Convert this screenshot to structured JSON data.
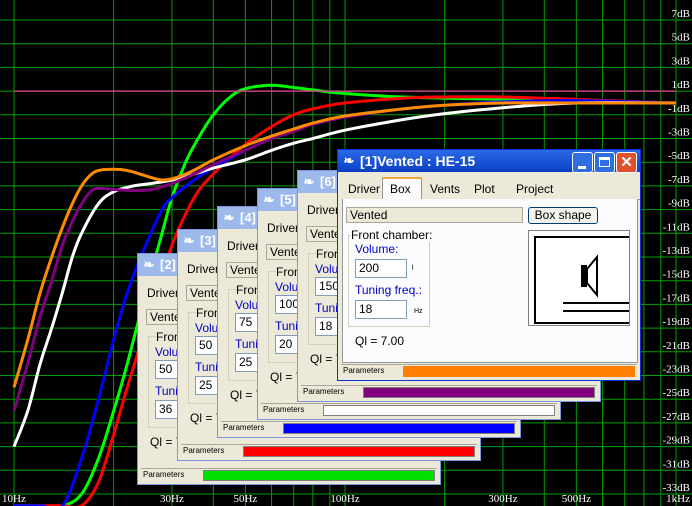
{
  "chart_data": {
    "type": "line",
    "y_labels": [
      "7dB",
      "5dB",
      "3dB",
      "1dB",
      "-1dB",
      "-3dB",
      "-5dB",
      "-7dB",
      "-9dB",
      "-11dB",
      "-13dB",
      "-15dB",
      "-17dB",
      "-19dB",
      "-21dB",
      "-23dB",
      "-25dB",
      "-27dB",
      "-29dB",
      "-31dB",
      "-33dB"
    ],
    "x_labels": [
      "10Hz",
      "30Hz",
      "50Hz",
      "100Hz",
      "300Hz",
      "500Hz",
      "1kHz"
    ],
    "x_log": true,
    "xlim": [
      10,
      1000
    ],
    "ylim": [
      -34,
      8
    ],
    "grid": true,
    "series": [
      {
        "color": "#00ff00",
        "x": [
          10,
          12,
          14,
          16,
          18,
          20,
          22,
          25,
          28,
          30,
          33,
          36,
          40,
          45,
          50,
          60,
          70,
          80,
          100,
          150,
          300,
          1000
        ],
        "y": [
          -34,
          -34,
          -34,
          -33,
          -30,
          -26,
          -22,
          -16,
          -11,
          -8,
          -5,
          -3,
          -1,
          0.5,
          1.2,
          1.5,
          1.3,
          1.1,
          0.8,
          0.5,
          0.3,
          0
        ]
      },
      {
        "color": "#ff0000",
        "x": [
          10,
          12,
          14,
          16,
          18,
          20,
          22,
          25,
          28,
          30,
          35,
          40,
          50,
          60,
          70,
          80,
          100,
          150,
          200,
          300,
          500,
          1000
        ],
        "y": [
          -34,
          -34,
          -34,
          -34,
          -32,
          -28,
          -24,
          -19,
          -15,
          -12,
          -8,
          -6,
          -3.5,
          -2,
          -1,
          -0.5,
          0,
          0.4,
          0.5,
          0.5,
          0.3,
          0
        ]
      },
      {
        "color": "#0000ff",
        "x": [
          10,
          12,
          14,
          16,
          18,
          20,
          22,
          25,
          28,
          30,
          35,
          40,
          50,
          60,
          70,
          80,
          100,
          150,
          200,
          300,
          500,
          1000
        ],
        "y": [
          -34,
          -34,
          -34,
          -30,
          -25,
          -20,
          -16,
          -12,
          -9,
          -8,
          -6.5,
          -5.5,
          -4,
          -3,
          -2.3,
          -1.8,
          -1.2,
          -0.5,
          -0.2,
          0.1,
          0.2,
          0
        ]
      },
      {
        "color": "#ffffff",
        "x": [
          10,
          11,
          12,
          13,
          14,
          15,
          16,
          18,
          20,
          23,
          26,
          30,
          35,
          40,
          50,
          60,
          70,
          80,
          100,
          150,
          200,
          300,
          500,
          1000
        ],
        "y": [
          -29,
          -26,
          -22,
          -19,
          -16,
          -13,
          -11,
          -8.5,
          -7.5,
          -7,
          -6.8,
          -6.5,
          -6,
          -5.5,
          -4.8,
          -4,
          -3.4,
          -3,
          -2.3,
          -1.4,
          -0.9,
          -0.4,
          0,
          0
        ]
      },
      {
        "color": "#800080",
        "x": [
          10,
          11,
          12,
          13,
          14,
          15,
          16,
          17,
          18,
          20,
          23,
          26,
          30,
          35,
          40,
          50,
          60,
          70,
          80,
          100,
          150,
          200,
          300,
          500,
          1000
        ],
        "y": [
          -26,
          -22,
          -18,
          -15,
          -12,
          -10,
          -8.5,
          -7.5,
          -7.2,
          -7.3,
          -7.4,
          -7.3,
          -6.8,
          -6,
          -5.2,
          -4,
          -3,
          -2.4,
          -1.8,
          -1.2,
          -0.5,
          -0.2,
          0,
          0,
          0
        ]
      },
      {
        "color": "#ff8c00",
        "x": [
          10,
          11,
          12,
          13,
          14,
          15,
          16,
          17,
          18,
          20,
          22,
          24,
          26,
          28,
          30,
          33,
          36,
          40,
          50,
          60,
          70,
          80,
          100,
          150,
          200,
          300,
          500,
          1000
        ],
        "y": [
          -24,
          -20,
          -16,
          -13,
          -10.5,
          -8.5,
          -7,
          -6.1,
          -5.7,
          -5.6,
          -5.7,
          -6,
          -6.3,
          -6.5,
          -6.4,
          -6,
          -5.5,
          -4.8,
          -3.6,
          -2.8,
          -2.2,
          -1.7,
          -1.1,
          -0.5,
          -0.2,
          0,
          0,
          0
        ]
      },
      {
        "color": "#c04080",
        "x": [
          10,
          1000
        ],
        "y": [
          1,
          1
        ]
      }
    ]
  },
  "windows": [
    {
      "title": "[2]",
      "tab": "Driver",
      "vented": "Vente",
      "front": "Fron",
      "volume_label": "Volu",
      "volume": "50",
      "tuning_label": "Tuni",
      "tuning": "36",
      "ql": "Ql = 7",
      "status": "Parameters",
      "bar": "#00e000"
    },
    {
      "title": "[3]",
      "tab": "Driver",
      "vented": "Vente",
      "front": "Front",
      "volume_label": "Volu",
      "volume": "50",
      "tuning_label": "Tuni",
      "tuning": "25",
      "ql": "Ql = 7",
      "status": "Parameters",
      "bar": "#ff0000"
    },
    {
      "title": "[4]",
      "tab": "Driver",
      "vented": "Vente",
      "front": "Front",
      "volume_label": "Volu",
      "volume": "75",
      "tuning_label": "Tuni",
      "tuning": "25",
      "ql": "Ql = 7",
      "status": "Parameters",
      "bar": "#0000ff"
    },
    {
      "title": "[5]",
      "tab": "Driver",
      "vented": "Vente",
      "front": "Front",
      "volume_label": "Volu",
      "volume": "100",
      "tuning_label": "Tuni",
      "tuning": "20",
      "ql": "Ql = 7",
      "status": "Parameters",
      "bar": "#ffffff"
    },
    {
      "title": "[6]",
      "tab": "Driver",
      "vented": "Vente",
      "front": "Front",
      "volume_label": "Volu",
      "volume": "150",
      "tuning_label": "Tuni",
      "tuning": "18",
      "ql": "Ql = 7",
      "status": "Parameters",
      "bar": "#800080"
    }
  ],
  "main_window": {
    "title": "[1]Vented : HE-15",
    "tabs": [
      "Driver",
      "Box",
      "Vents",
      "Plot",
      "Project"
    ],
    "vented": "Vented",
    "box_shape_button": "Box shape",
    "front_chamber": "Front chamber:",
    "volume_label": "Volume:",
    "volume": "200",
    "volume_unit": "l",
    "tuning_label": "Tuning freq.:",
    "tuning": "18",
    "tuning_unit": "Hz",
    "ql": "Ql = 7.00",
    "status": "Parameters",
    "bar": "#ff8000"
  }
}
